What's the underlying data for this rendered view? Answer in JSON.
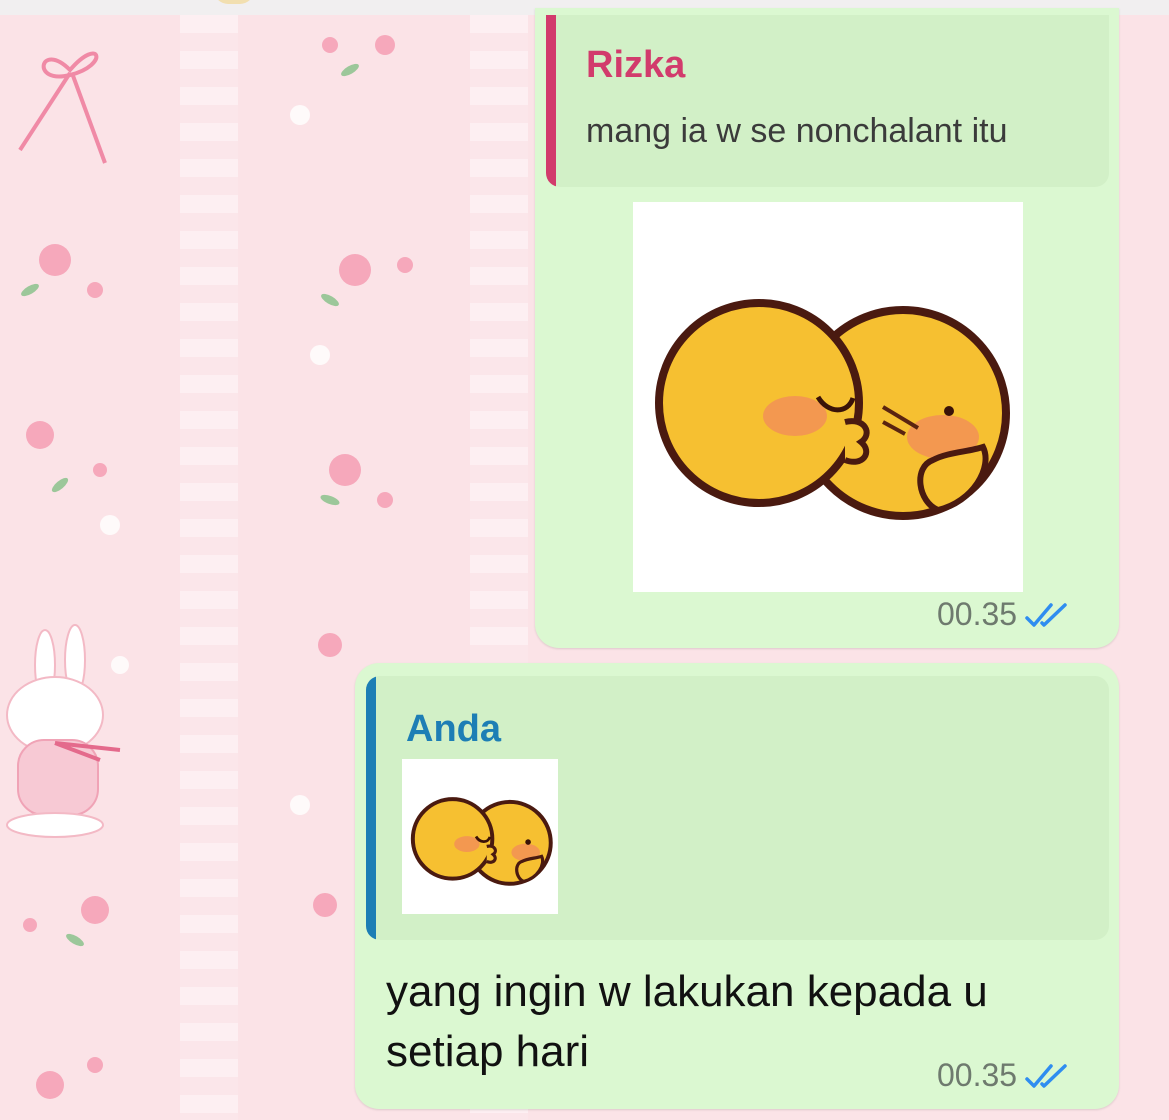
{
  "messages": [
    {
      "reply_to": {
        "sender": "Rizka",
        "text": "mang ia w se nonchalant itu"
      },
      "body": {
        "type": "sticker",
        "sticker": "kissing-duck-sticker"
      },
      "time": "00.35",
      "status": "read"
    },
    {
      "reply_to": {
        "sender": "Anda",
        "preview": "kissing-duck-sticker-thumbnail"
      },
      "body": {
        "type": "text",
        "text": "yang ingin w lakukan kepada u setiap hari"
      },
      "time": "00.35",
      "status": "read"
    }
  ],
  "colors": {
    "bubble": "#dbf8d1",
    "quote_bg": "#d2f0c7",
    "rizka_accent": "#d23b6c",
    "anda_accent": "#1d7eb5",
    "read_tick": "#2f8df0",
    "wallpaper": "#fbe3e7"
  }
}
